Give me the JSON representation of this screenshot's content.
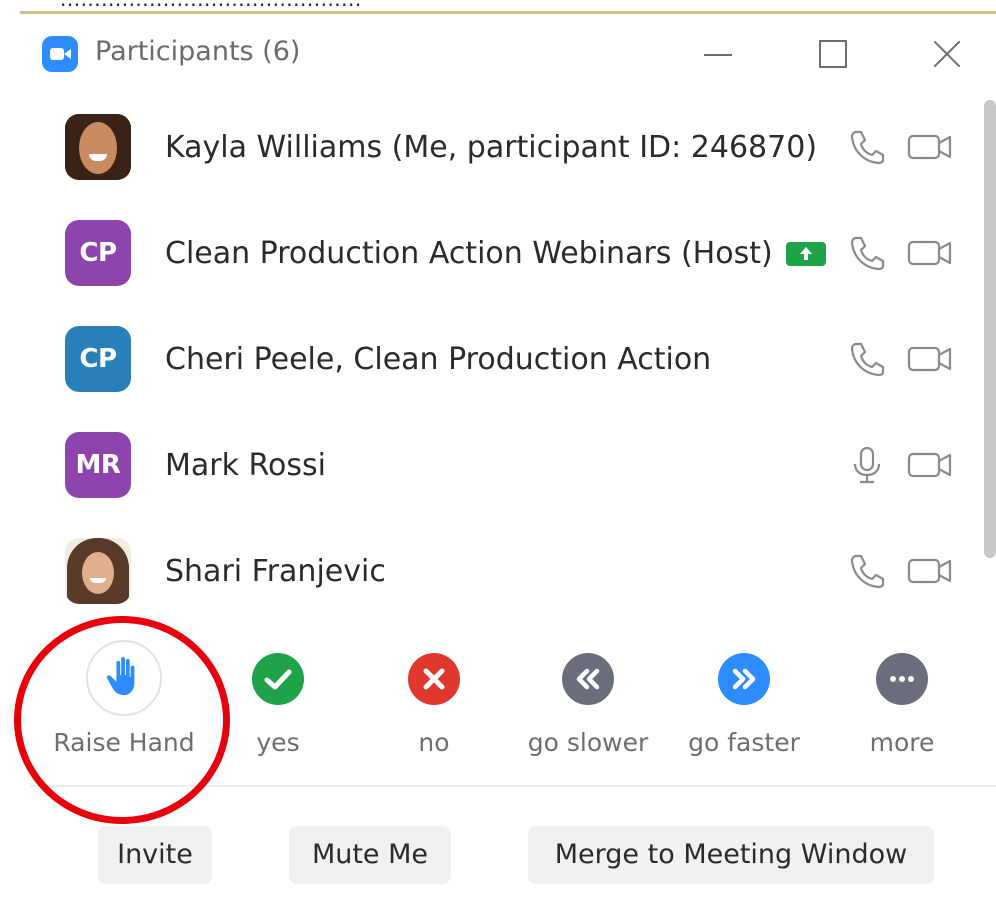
{
  "window": {
    "title": "Participants (6)",
    "top_cut_text": "............................................"
  },
  "participants": [
    {
      "name": "Kayla Williams (Me, participant ID: 246870)",
      "avatar_type": "photo",
      "audio_icon": "phone-icon",
      "video_icon": "video-camera-icon",
      "host_badge": false
    },
    {
      "name": "Clean Production Action Webinars (Host)",
      "avatar_type": "initials",
      "initials": "CP",
      "avatar_color": "#8e44ad",
      "audio_icon": "phone-icon",
      "video_icon": "video-camera-icon",
      "host_badge": true,
      "host_badge_color": "#1fa34a"
    },
    {
      "name": "Cheri Peele, Clean Production Action",
      "avatar_type": "initials",
      "initials": "CP",
      "avatar_color": "#2980b9",
      "audio_icon": "phone-icon",
      "video_icon": "video-camera-icon",
      "host_badge": false
    },
    {
      "name": "Mark Rossi",
      "avatar_type": "initials",
      "initials": "MR",
      "avatar_color": "#8e44ad",
      "audio_icon": "microphone-icon",
      "video_icon": "video-camera-icon",
      "host_badge": false
    },
    {
      "name": "Shari Franjevic",
      "avatar_type": "photo",
      "audio_icon": "phone-icon",
      "video_icon": "video-camera-icon",
      "host_badge": false
    }
  ],
  "reactions": [
    {
      "label": "Raise Hand",
      "icon": "raise-hand-icon",
      "color": "#2d8cff"
    },
    {
      "label": "yes",
      "icon": "checkmark-icon",
      "color": "#1fa34a"
    },
    {
      "label": "no",
      "icon": "x-icon",
      "color": "#e0382f"
    },
    {
      "label": "go slower",
      "icon": "rewind-icon",
      "color": "#6a6d7c"
    },
    {
      "label": "go faster",
      "icon": "fast-forward-icon",
      "color": "#2d8cff"
    },
    {
      "label": "more",
      "icon": "more-dots-icon",
      "color": "#6a6d7c"
    }
  ],
  "buttons": {
    "invite": "Invite",
    "mute_me": "Mute Me",
    "merge": "Merge to Meeting Window"
  },
  "colors": {
    "brand_blue": "#2d8cff",
    "highlight_ring": "#e8000d",
    "icon_gray": "#8a8a8a"
  }
}
